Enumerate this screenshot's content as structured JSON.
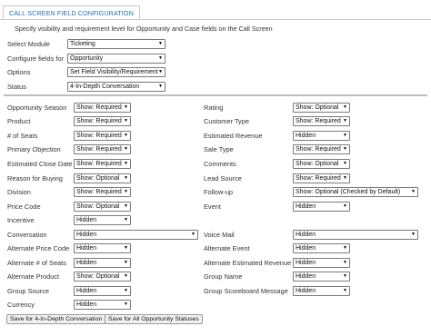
{
  "tab": "CALL SCREEN FIELD CONFIGURATION",
  "intro": "Specify visibility and requirement level for Opportunity and Case fields on the Call Screen",
  "top_fields": [
    {
      "label": "Select Module",
      "value": "Ticketing"
    },
    {
      "label": "Configure fields for",
      "value": "Opportunity"
    },
    {
      "label": "Options",
      "value": "Set Field Visibility/Requirement"
    },
    {
      "label": "Status",
      "value": "4-In-Depth Conversation"
    }
  ],
  "left_fields": [
    {
      "label": "Opportunity Season",
      "value": "Show: Required"
    },
    {
      "label": "Product",
      "value": "Show: Required"
    },
    {
      "label": "# of Seats",
      "value": "Show: Required"
    },
    {
      "label": "Primary Objection",
      "value": "Show: Required"
    },
    {
      "label": "Estimated Close Date",
      "value": "Show: Required"
    },
    {
      "label": "Reason for Buying",
      "value": "Show: Optional"
    },
    {
      "label": "Division",
      "value": "Show: Required"
    },
    {
      "label": "Price Code",
      "value": "Show: Optional"
    },
    {
      "label": "Incentive",
      "value": "Hidden"
    },
    {
      "label": "Conversation",
      "value": "Hidden"
    },
    {
      "label": "Alternate Price Code",
      "value": "Hidden"
    },
    {
      "label": "Alternate # of Seats",
      "value": "Hidden"
    },
    {
      "label": "Alternate Product",
      "value": "Show: Optional"
    },
    {
      "label": "Group Source",
      "value": "Hidden"
    },
    {
      "label": "Currency",
      "value": "Hidden"
    }
  ],
  "right_fields": [
    {
      "label": "Rating",
      "value": "Show: Optional"
    },
    {
      "label": "Customer Type",
      "value": "Show: Required"
    },
    {
      "label": "Estimated Revenue",
      "value": "Hidden"
    },
    {
      "label": "Sale Type",
      "value": "Show: Required"
    },
    {
      "label": "Comments",
      "value": "Show: Optional"
    },
    {
      "label": "Lead Source",
      "value": "Show: Required"
    },
    {
      "label": "Follow-up",
      "value": "Show: Optional (Checked by Default)"
    },
    {
      "label": "Event",
      "value": "Hidden"
    },
    {
      "label": "Voice Mail",
      "value": "Hidden"
    },
    {
      "label": "Alternate Event",
      "value": "Hidden"
    },
    {
      "label": "Alternate Estimated Revenue",
      "value": "Hidden"
    },
    {
      "label": "Group Name",
      "value": "Hidden"
    },
    {
      "label": "Group Scoreboard Message",
      "value": "Hidden"
    }
  ],
  "buttons": {
    "save_status": "Save for 4-In-Depth Conversation",
    "save_all": "Save for All Opportunity Statuses"
  }
}
